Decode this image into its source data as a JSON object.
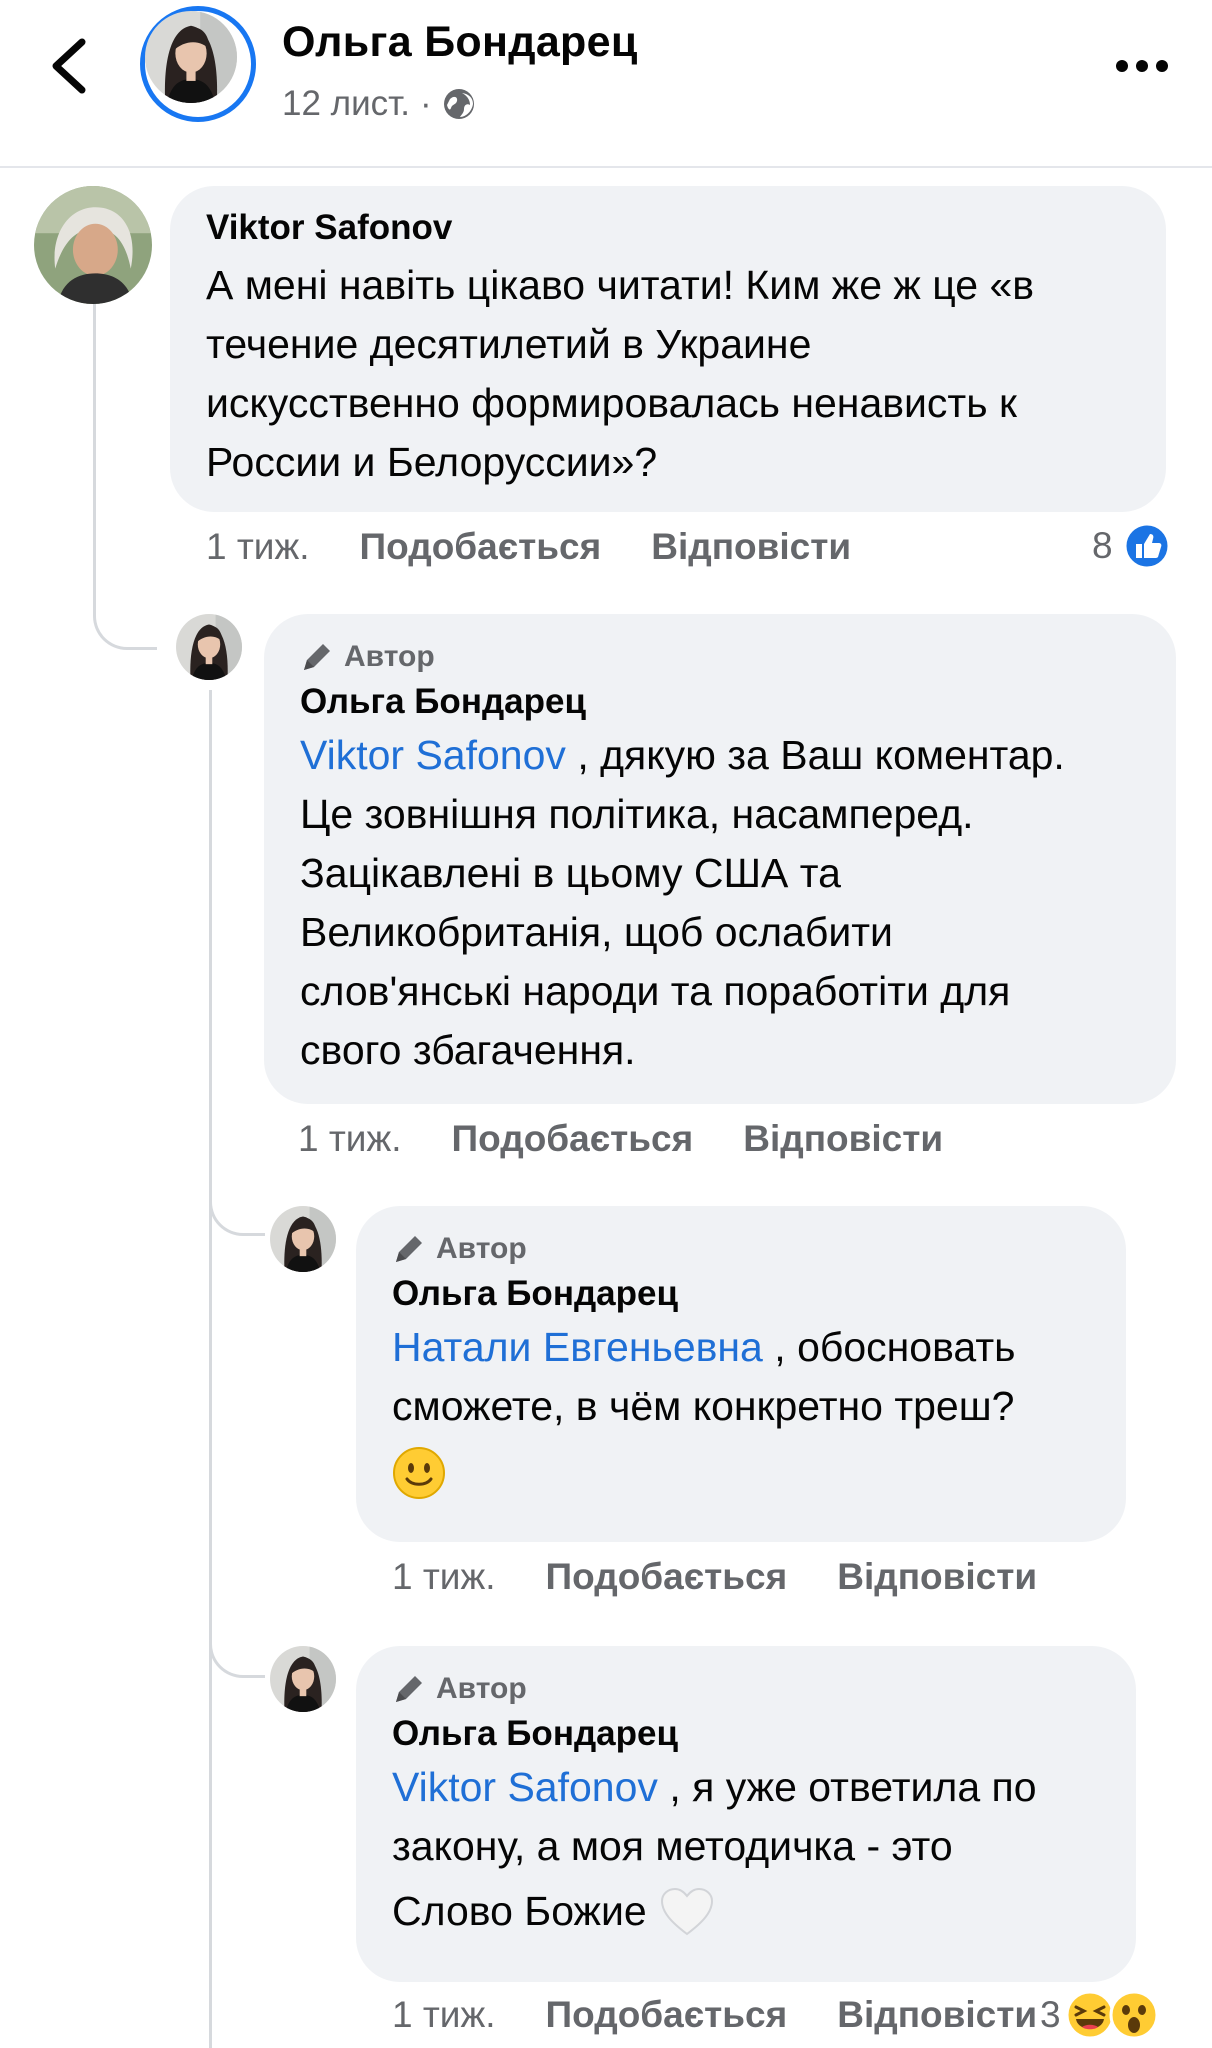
{
  "header": {
    "name": "Ольга Бондарец",
    "date": "12 лист.",
    "separator": "·",
    "back_icon": "chevron-left-icon",
    "privacy_icon": "globe-icon",
    "more_icon": "more-dots-icon"
  },
  "comments": [
    {
      "name": "Viktor Safonov",
      "text": "А мені навіть цікаво читати! Ким же ж це «в течение десятилетий в Украине искусственно формировалась ненависть к России и Белоруссии»?",
      "lines": [
        "А мені навіть цікаво читати! Ким же ж це «в",
        "течение десятилетий в Украине",
        "искусственно формировалась ненависть к",
        "России и Белоруссии»?"
      ],
      "time": "1 тиж.",
      "like": "Подобається",
      "reply": "Відповісти",
      "reactions": {
        "count": "8",
        "icons": [
          "like-reaction-icon"
        ]
      }
    },
    {
      "badge": "Автор",
      "name": "Ольга Бондарец",
      "mention": "Viktor Safonov",
      "first_line_rest": ", дякую за Ваш коментар.",
      "lines": [
        "Це зовнішня політика, насамперед.",
        "Зацікавлені в цьому США та",
        "Великобританія, щоб ослабити",
        "слов'янські народи та поработіти для",
        "свого збагачення."
      ],
      "time": "1 тиж.",
      "like": "Подобається",
      "reply": "Відповісти"
    },
    {
      "badge": "Автор",
      "name": "Ольга Бондарец",
      "mention": "Натали Евгеньевна",
      "first_line_rest": ", обосновать",
      "lines": [
        "сможете, в чём конкретно треш?"
      ],
      "emoji": "slightly-smiling-face-icon",
      "time": "1 тиж.",
      "like": "Подобається",
      "reply": "Відповісти"
    },
    {
      "badge": "Автор",
      "name": "Ольга Бондарец",
      "mention": "Viktor Safonov",
      "first_line_rest": ", я уже ответила по",
      "lines": [
        "закону, а моя методичка - это",
        "Слово Божие"
      ],
      "emoji": "white-heart-icon",
      "time": "1 тиж.",
      "like": "Подобається",
      "reply": "Відповісти",
      "reactions": {
        "count": "3",
        "icons": [
          "laughing-reaction-icon",
          "wow-reaction-icon"
        ]
      }
    }
  ]
}
